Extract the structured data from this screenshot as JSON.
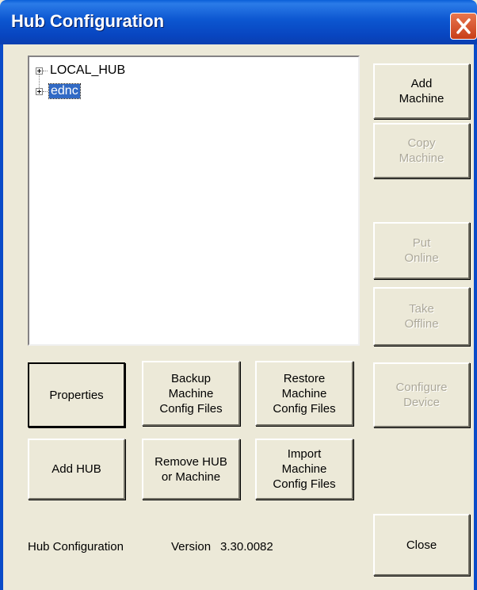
{
  "window": {
    "title": "Hub Configuration"
  },
  "tree": {
    "items": [
      {
        "label": "LOCAL_HUB",
        "selected": false
      },
      {
        "label": "ednc",
        "selected": true
      }
    ]
  },
  "buttons": {
    "add_machine": "Add\nMachine",
    "copy_machine": "Copy\nMachine",
    "put_online": "Put\nOnline",
    "take_offline": "Take\nOffline",
    "properties": "Properties",
    "backup": "Backup\nMachine\nConfig Files",
    "restore": "Restore\nMachine\nConfig Files",
    "configure_device": "Configure\nDevice",
    "add_hub": "Add HUB",
    "remove": "Remove HUB\nor Machine",
    "import": "Import\nMachine\nConfig Files",
    "close": "Close"
  },
  "footer": {
    "app_name": "Hub Configuration",
    "version_label": "Version",
    "version": "3.30.0082"
  },
  "colors": {
    "titlebar": "#0c56d0",
    "dialog_bg": "#ece9d8",
    "selection": "#316ac5",
    "disabled_text": "#aca899"
  }
}
